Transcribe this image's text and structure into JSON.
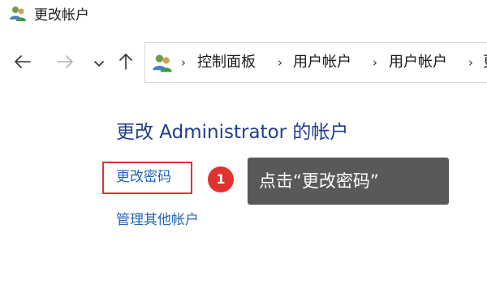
{
  "window": {
    "title": "更改帐户",
    "icon": "user-accounts-icon"
  },
  "navigation": {
    "back_icon": "arrow-left-icon",
    "forward_icon": "arrow-right-icon",
    "recent_icon": "chevron-down-icon",
    "up_icon": "arrow-up-icon",
    "breadcrumb": [
      "控制面板",
      "用户帐户",
      "用户帐户",
      "更"
    ],
    "separator": "›"
  },
  "main": {
    "heading": "更改 Administrator 的帐户",
    "links": [
      "更改密码",
      "管理其他帐户"
    ]
  },
  "annotation": {
    "step_number": "1",
    "callout_text": "点击“更改密码”",
    "highlight_color": "#e0322f",
    "callout_color": "#595959"
  }
}
